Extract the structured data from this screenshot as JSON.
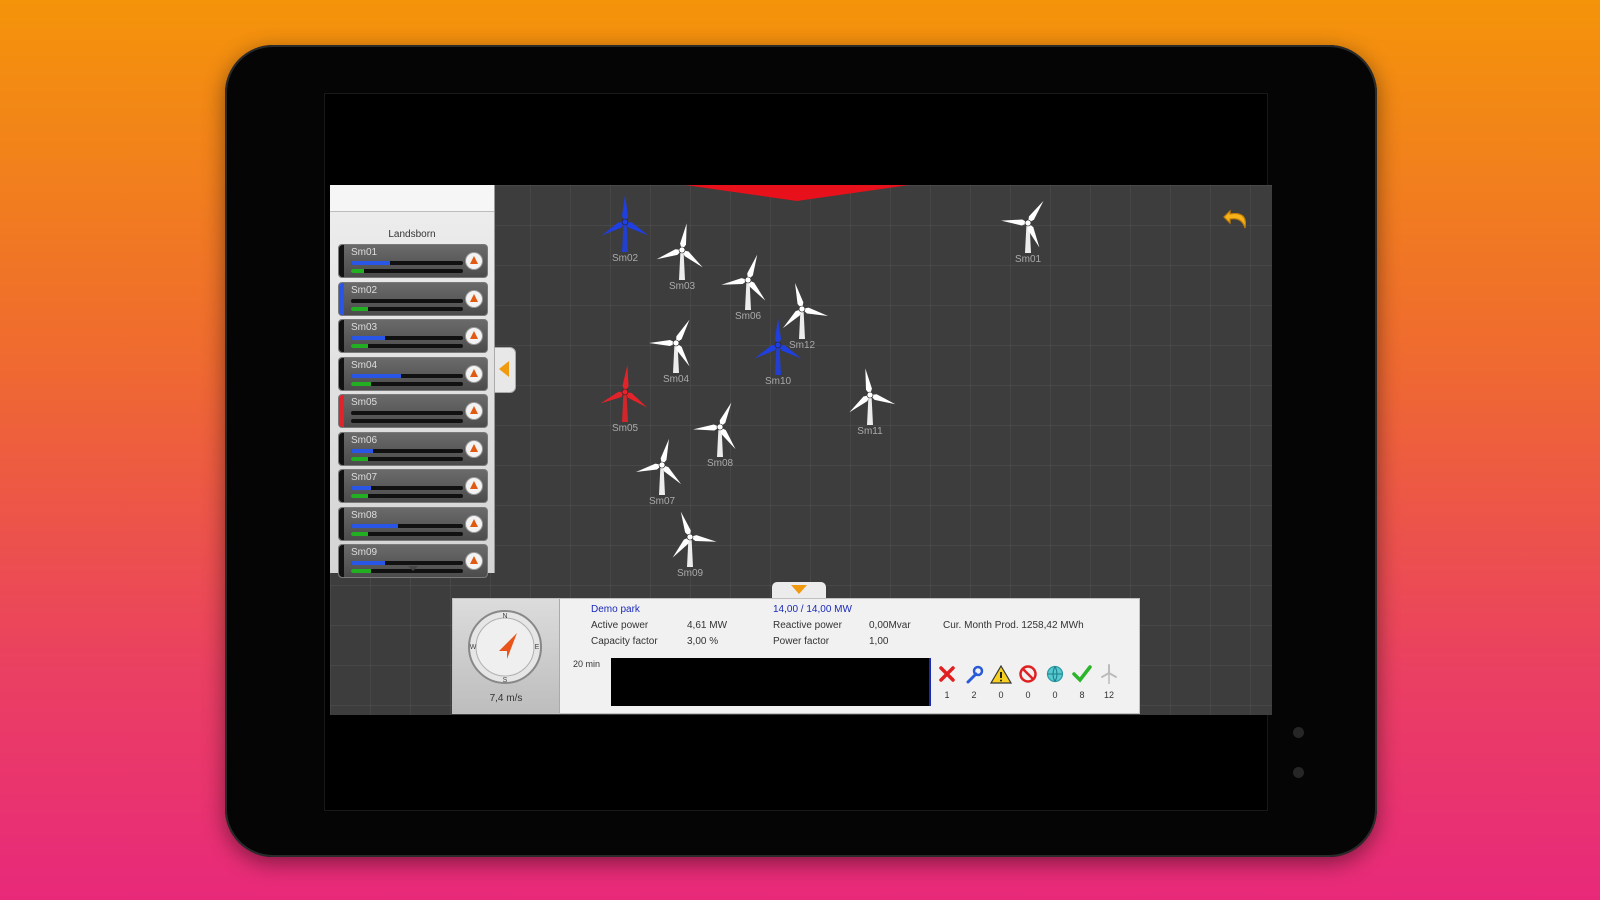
{
  "device": {
    "background_gradient": [
      "#f4940a",
      "#e8297a"
    ],
    "frame_color": "#050505"
  },
  "app": {
    "top_tab_color": "#e8101a",
    "back_icon": "undo-arrow-icon",
    "accent": "#f09a10",
    "panel": {
      "title": "Landsborn",
      "collapse_icon": "chevron-left-icon",
      "more_icon": "chevron-down-icon",
      "items": [
        {
          "label": "Sm01",
          "stripe": "#111111",
          "power": 0.35,
          "wind": 0.12
        },
        {
          "label": "Sm02",
          "stripe": "#2a56e8",
          "power": 0.0,
          "wind": 0.15
        },
        {
          "label": "Sm03",
          "stripe": "#111111",
          "power": 0.3,
          "wind": 0.15
        },
        {
          "label": "Sm04",
          "stripe": "#111111",
          "power": 0.45,
          "wind": 0.18
        },
        {
          "label": "Sm05",
          "stripe": "#e3232a",
          "power": 0.0,
          "wind": 0.0
        },
        {
          "label": "Sm06",
          "stripe": "#111111",
          "power": 0.2,
          "wind": 0.15
        },
        {
          "label": "Sm07",
          "stripe": "#111111",
          "power": 0.18,
          "wind": 0.15
        },
        {
          "label": "Sm08",
          "stripe": "#111111",
          "power": 0.42,
          "wind": 0.15
        },
        {
          "label": "Sm09",
          "stripe": "#111111",
          "power": 0.3,
          "wind": 0.18
        }
      ]
    },
    "turbines": [
      {
        "label": "Sm02",
        "color": "#1f3fe0"
      },
      {
        "label": "Sm03",
        "color": "#ffffff"
      },
      {
        "label": "Sm06",
        "color": "#ffffff"
      },
      {
        "label": "Sm12",
        "color": "#ffffff"
      },
      {
        "label": "Sm04",
        "color": "#ffffff"
      },
      {
        "label": "Sm10",
        "color": "#1f3fe0"
      },
      {
        "label": "Sm05",
        "color": "#e3232a"
      },
      {
        "label": "Sm11",
        "color": "#ffffff"
      },
      {
        "label": "Sm08",
        "color": "#ffffff"
      },
      {
        "label": "Sm07",
        "color": "#ffffff"
      },
      {
        "label": "Sm09",
        "color": "#ffffff"
      },
      {
        "label": "Sm01",
        "color": "#ffffff"
      }
    ],
    "info": {
      "park_name": "Demo park",
      "capacity": "14,00 / 14,00 MW",
      "active_power_label": "Active power",
      "active_power_value": "4,61 MW",
      "reactive_power_label": "Reactive power",
      "reactive_power_value": "0,00Mvar",
      "capacity_factor_label": "Capacity factor",
      "capacity_factor_value": "3,00 %",
      "power_factor_label": "Power factor",
      "power_factor_value": "1,00",
      "month_prod": "Cur. Month Prod. 1258,42 MWh",
      "wind_speed": "7,4 m/s",
      "minutes": "20 min",
      "compass": {
        "n": "N",
        "e": "E",
        "s": "S",
        "w": "W"
      },
      "statuses": [
        {
          "icon": "error-x-icon",
          "count": "1"
        },
        {
          "icon": "wrench-icon",
          "count": "2"
        },
        {
          "icon": "warning-icon",
          "count": "0"
        },
        {
          "icon": "stop-icon",
          "count": "0"
        },
        {
          "icon": "globe-icon",
          "count": "0"
        },
        {
          "icon": "check-icon",
          "count": "8"
        },
        {
          "icon": "turbine-icon",
          "count": "12"
        }
      ]
    }
  }
}
